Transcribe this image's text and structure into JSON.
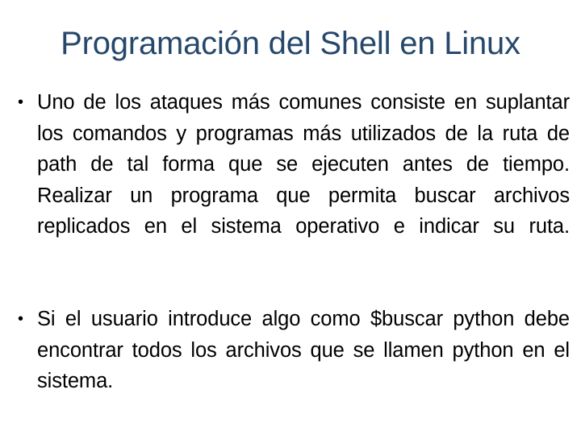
{
  "slide": {
    "title": "Programación del Shell en Linux",
    "title_color": "#26486b",
    "background_color": "#ffffff",
    "body_color": "#000000",
    "bullet_glyph": "•",
    "bullets": [
      {
        "marker": "•",
        "text": "Uno de los ataques más comunes consiste en suplantar los comandos y programas más utilizados de la ruta de path de tal forma que se ejecuten antes de tiempo. Realizar un programa que permita buscar archivos replicados en el sistema operativo e indicar su ruta."
      },
      {
        "marker": "•",
        "text": "Si el usuario introduce algo como $buscar python debe encontrar todos los archivos que se llamen python en el sistema."
      }
    ]
  }
}
